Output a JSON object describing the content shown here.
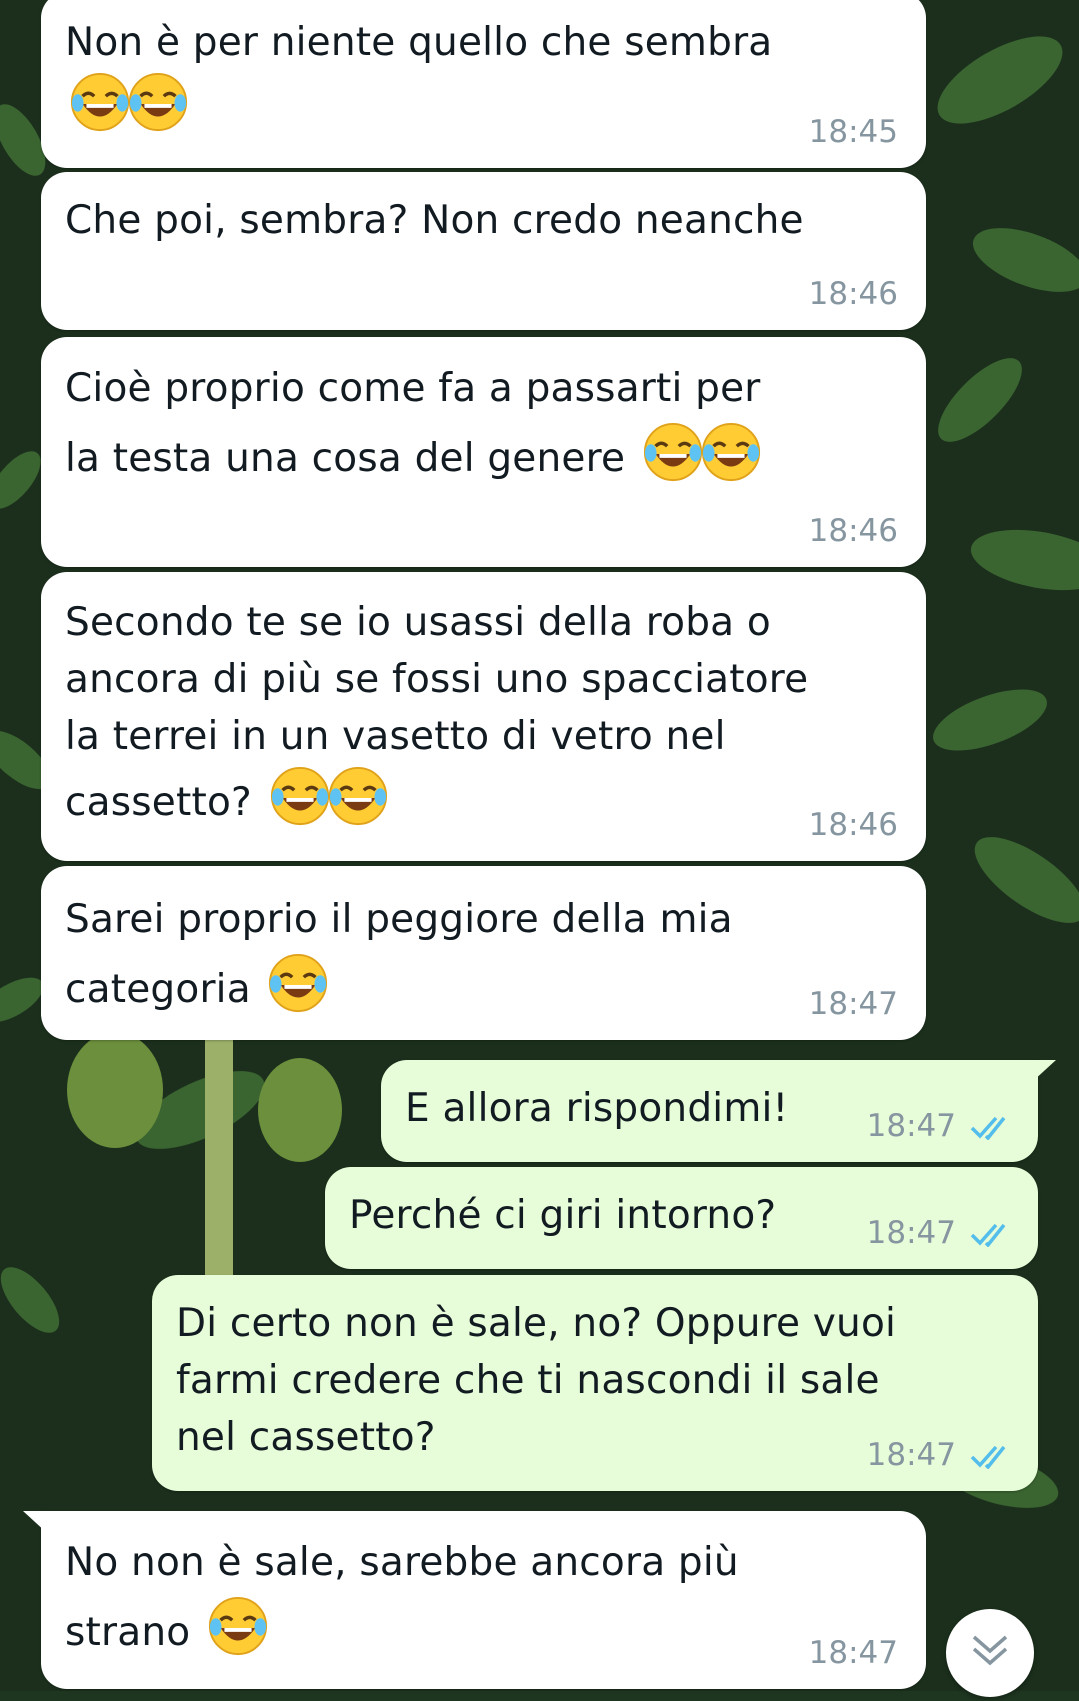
{
  "chat": {
    "messages": [
      {
        "direction": "in",
        "text": "Non è per niente quello che sembra\n",
        "emoji_count": 2,
        "time": "18:45"
      },
      {
        "direction": "in",
        "text": "Che poi, sembra? Non credo neanche",
        "emoji_count": 0,
        "time": "18:46"
      },
      {
        "direction": "in",
        "text": "Cioè proprio come fa a passarti per\nla testa una cosa del genere",
        "emoji_count": 2,
        "time": "18:46"
      },
      {
        "direction": "in",
        "text": "Secondo te se io usassi della roba o\nancora di più se fossi uno spacciatore\nla terrei in un vasetto di vetro nel\ncassetto?",
        "emoji_count": 2,
        "time": "18:46"
      },
      {
        "direction": "in",
        "text": "Sarei proprio il peggiore della mia\ncategoria",
        "emoji_count": 1,
        "time": "18:47"
      },
      {
        "direction": "out",
        "text": "E allora rispondimi!",
        "time": "18:47",
        "status": "read"
      },
      {
        "direction": "out",
        "text": "Perché ci giri intorno?",
        "time": "18:47",
        "status": "read"
      },
      {
        "direction": "out",
        "text": "Di certo non è sale, no? Oppure vuoi\nfarmi credere che ti nascondi il sale\nnel cassetto?",
        "time": "18:47",
        "status": "read"
      },
      {
        "direction": "in",
        "text": "No non è sale, sarebbe ancora più\nstrano",
        "emoji_count": 1,
        "time": "18:47"
      }
    ]
  },
  "icons": {
    "emoji": "face-with-tears-of-joy-icon",
    "read_receipt": "double-check-icon",
    "scroll_down": "double-chevron-down-icon"
  },
  "colors": {
    "incoming_bubble": "#ffffff",
    "outgoing_bubble": "#e7fcd8",
    "timestamp": "#8696a0",
    "read_ticks": "#53bdeb"
  }
}
